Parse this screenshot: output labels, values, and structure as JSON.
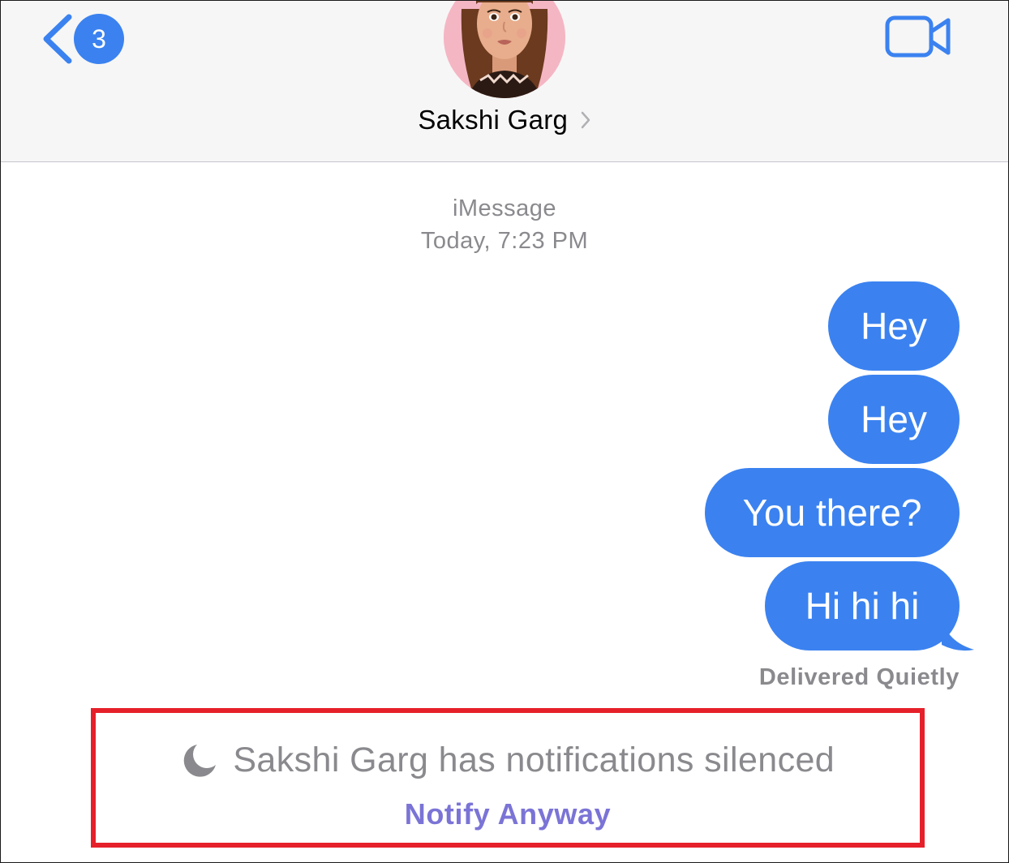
{
  "header": {
    "back_badge_count": "3",
    "contact_name": "Sakshi Garg"
  },
  "thread": {
    "service": "iMessage",
    "timestamp": "Today, 7:23 PM"
  },
  "messages": [
    {
      "text": "Hey",
      "direction": "outgoing"
    },
    {
      "text": "Hey",
      "direction": "outgoing"
    },
    {
      "text": "You there?",
      "direction": "outgoing"
    },
    {
      "text": "Hi hi hi",
      "direction": "outgoing"
    }
  ],
  "status": {
    "delivery": "Delivered Quietly"
  },
  "focus_notice": {
    "icon": "moon-icon",
    "text": "Sakshi Garg has notifications silenced",
    "action_label": "Notify Anyway"
  },
  "colors": {
    "accent": "#3b82f0",
    "bubble": "#3b82f0",
    "secondary_text": "#8a8a8e",
    "notify_link": "#7b74d6",
    "highlight_box": "#e6202a"
  }
}
